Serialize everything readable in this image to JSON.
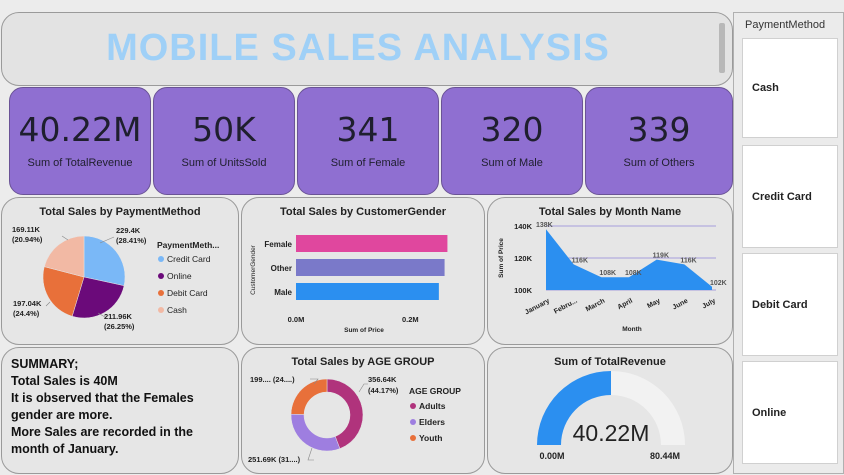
{
  "title": "MOBILE SALES ANALYSIS",
  "kpis": [
    {
      "value": "40.22M",
      "label": "Sum of TotalRevenue"
    },
    {
      "value": "50K",
      "label": "Sum of UnitsSold"
    },
    {
      "value": "341",
      "label": "Sum of Female"
    },
    {
      "value": "320",
      "label": "Sum of Male"
    },
    {
      "value": "339",
      "label": "Sum of Others"
    }
  ],
  "slicer": {
    "title": "PaymentMethod",
    "options": [
      "Cash",
      "Credit Card",
      "Debit Card",
      "Online"
    ]
  },
  "summary": {
    "lines": [
      "SUMMARY;",
      "Total Sales is 40M",
      "It is observed that the Females",
      "gender are more.",
      "More Sales are recorded in the",
      "month of January."
    ]
  },
  "colors": {
    "kpi_bg": "#8f6fd1",
    "title": "#9fd0f7",
    "credit_card": "#7ab8f7",
    "online": "#6b0a7a",
    "debit_card": "#e8703a",
    "cash": "#f2b9a4",
    "female": "#e0479e",
    "other": "#7a79c9",
    "male": "#2b8ff0",
    "area": "#2b8ff0",
    "adults": "#b0337c",
    "elders": "#9e7ee0",
    "youth": "#e8703a",
    "gauge": "#2b8ff0"
  },
  "chart_data": [
    {
      "type": "pie",
      "title": "Total Sales by PaymentMethod",
      "legend_title": "PaymentMeth...",
      "categories": [
        "Credit Card",
        "Online",
        "Debit Card",
        "Cash"
      ],
      "values": [
        229400,
        211960,
        197040,
        169110
      ],
      "labels": [
        {
          "value": "229.4K",
          "pct": "(28.41%)"
        },
        {
          "value": "211.96K",
          "pct": "(26.25%)"
        },
        {
          "value": "197.04K",
          "pct": "(24.4%)"
        },
        {
          "value": "169.11K",
          "pct": "(20.94%)"
        }
      ],
      "legend_placement": "right"
    },
    {
      "type": "bar",
      "orientation": "horizontal",
      "title": "Total Sales by CustomerGender",
      "categories": [
        "Female",
        "Other",
        "Male"
      ],
      "values": [
        0.265,
        0.26,
        0.25
      ],
      "xlabel": "Sum of Price",
      "ylabel": "CustomerGender",
      "xticks": [
        "0.0M",
        "0.2M"
      ],
      "xlim": [
        0,
        0.28
      ]
    },
    {
      "type": "area",
      "title": "Total Sales by Month Name",
      "categories": [
        "January",
        "Febru...",
        "March",
        "April",
        "May",
        "June",
        "July"
      ],
      "values": [
        138000,
        116000,
        108000,
        108000,
        119000,
        116000,
        102000
      ],
      "data_labels": [
        "138K",
        "116K",
        "108K",
        "108K",
        "119K",
        "116K",
        "102K"
      ],
      "yticks": [
        "140K",
        "120K",
        "100K"
      ],
      "ylim": [
        100000,
        140000
      ],
      "xlabel": "Month",
      "ylabel": "Sum of Price",
      "grid": true
    },
    {
      "type": "pie",
      "donut": true,
      "title": "Total Sales by AGE GROUP",
      "legend_title": "AGE GROUP",
      "categories": [
        "Adults",
        "Elders",
        "Youth"
      ],
      "values": [
        356640,
        251690,
        199000
      ],
      "data_labels": [
        "356.64K",
        "251.69K (31....)",
        "199.... (24....)"
      ],
      "data_label_pct": "(44.17%)",
      "legend_placement": "right"
    },
    {
      "type": "gauge",
      "title": "Sum of TotalRevenue",
      "value": 40.22,
      "min": 0,
      "max": 80.44,
      "value_label": "40.22M",
      "min_label": "0.00M",
      "max_label": "80.44M"
    }
  ]
}
